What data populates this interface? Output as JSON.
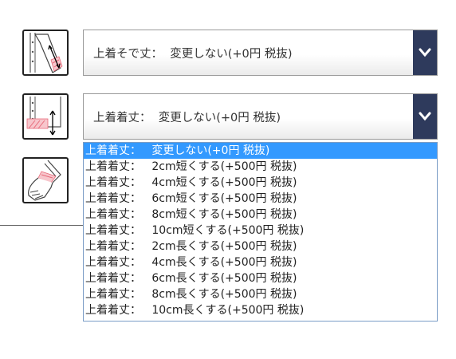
{
  "sleeve_select": {
    "label": "上着そで丈：  変更しない(+0円 税抜)"
  },
  "length_select": {
    "label": "上着着丈：  変更しない(+0円 税抜)",
    "options": [
      "上着着丈：   変更しない(+0円 税抜)",
      "上着着丈：   2cm短くする(+500円 税抜)",
      "上着着丈：   4cm短くする(+500円 税抜)",
      "上着着丈：   6cm短くする(+500円 税抜)",
      "上着着丈：   8cm短くする(+500円 税抜)",
      "上着着丈：   10cm短くする(+500円 税抜)",
      "上着着丈：   2cm長くする(+500円 税抜)",
      "上着着丈：   4cm長くする(+500円 税抜)",
      "上着着丈：   6cm長くする(+500円 税抜)",
      "上着着丈：   8cm長くする(+500円 税抜)",
      "上着着丈：   10cm長くする(+500円 税抜)"
    ],
    "selected_index": 0
  },
  "colors": {
    "arrow_bg": "#2e3a5c",
    "highlight": "#3399ff",
    "pink_accent": "#e86a7a"
  },
  "icons": [
    "sleeve-length-icon",
    "jacket-length-icon",
    "wrist-measure-icon",
    "chevron-down-icon"
  ]
}
